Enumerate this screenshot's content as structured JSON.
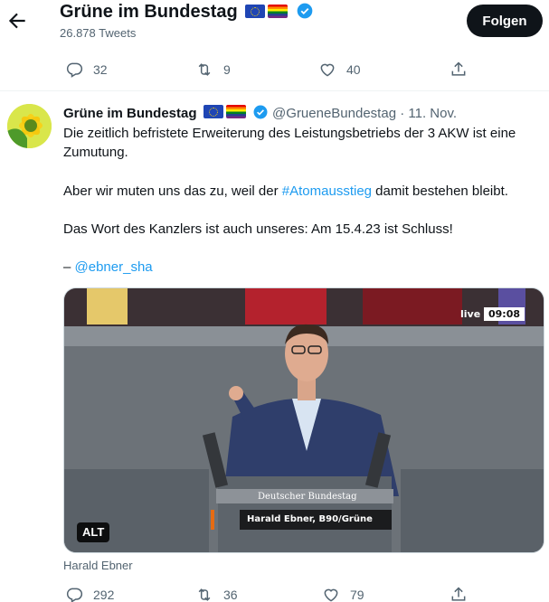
{
  "header": {
    "title": "Grüne im Bundestag",
    "tweet_count": "26.878 Tweets",
    "follow_label": "Folgen"
  },
  "prev_actions": {
    "replies": "32",
    "retweets": "9",
    "likes": "40"
  },
  "tweet": {
    "name": "Grüne im Bundestag",
    "handle": "@GrueneBundestag",
    "dot": "·",
    "date": "11. Nov.",
    "line1": "Die zeitlich befristete Erweiterung des Leistungsbetriebs der 3 AKW ist eine Zumutung.",
    "line2_pre": "Aber wir muten uns das zu, weil der ",
    "hashtag": "#Atomausstieg",
    "line2_post": " damit bestehen bleibt.",
    "line3": "Das Wort des Kanzlers ist auch unseres: Am 15.4.23 ist Schluss!",
    "mention_prefix": "– ",
    "mention": "@ebner_sha",
    "media": {
      "live_label": "live",
      "time": "09:08",
      "podium_label": "Deutscher Bundestag",
      "lower_third": "Harald Ebner, B90/Grüne",
      "alt_badge": "ALT"
    },
    "caption": "Harald Ebner",
    "actions": {
      "replies": "292",
      "retweets": "36",
      "likes": "79"
    }
  },
  "colors": {
    "accent": "#1d9bf0",
    "text": "#0f1419",
    "muted": "#536471",
    "follow_bg": "#0f1419"
  },
  "icons": [
    "back-arrow-icon",
    "verified-badge-icon",
    "eu-flag-icon",
    "rainbow-flag-icon",
    "reply-icon",
    "retweet-icon",
    "like-icon",
    "share-icon",
    "sunflower-logo"
  ]
}
